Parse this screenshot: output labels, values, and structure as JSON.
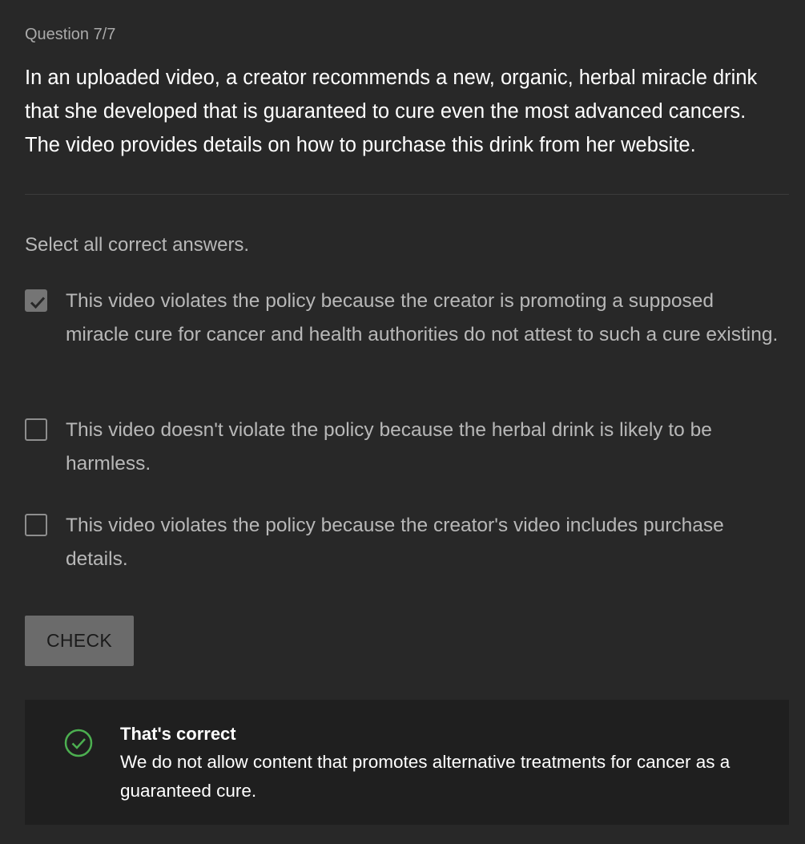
{
  "question": {
    "counter": "Question 7/7",
    "text": "In an uploaded video, a creator recommends a new, organic, herbal miracle drink that she developed that is guaranteed to cure even the most advanced cancers. The video provides details on how to purchase this drink from her website."
  },
  "instruction": "Select all correct answers.",
  "options": [
    {
      "label": "This video violates the policy because the creator is promoting a supposed miracle cure for cancer and health authorities do not attest to such a cure existing.",
      "checked": true
    },
    {
      "label": "This video doesn't violate the policy because the herbal drink is likely to be harmless.",
      "checked": false
    },
    {
      "label": "This video violates the policy because the creator's video includes purchase details.",
      "checked": false
    }
  ],
  "check_button": {
    "label": "CHECK"
  },
  "feedback": {
    "icon": "check-circle-icon",
    "title": "That's correct",
    "body": "We do not allow content that promotes alternative treatments for cancer as a guaranteed cure."
  },
  "colors": {
    "background": "#282828",
    "feedback_background": "#1f1f1f",
    "success_green": "#4caf50",
    "button_background": "#6b6b6b"
  }
}
